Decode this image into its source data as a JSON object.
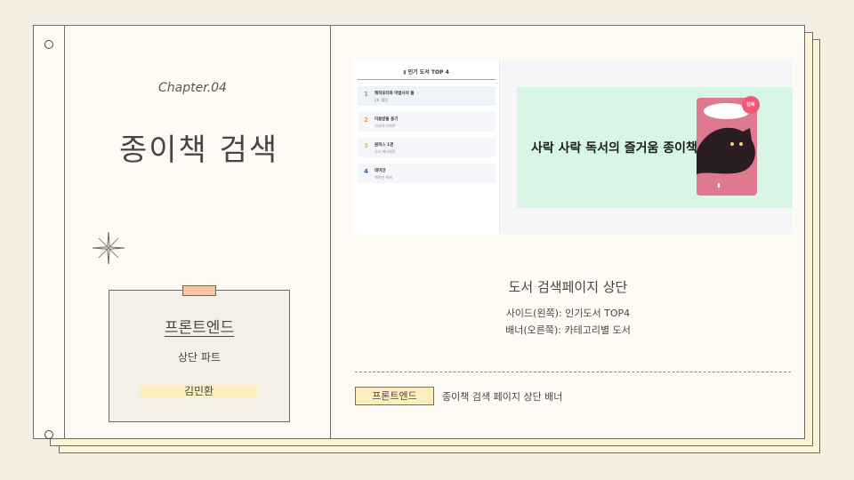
{
  "left": {
    "chapter": "Chapter.04",
    "title": "종이책 검색",
    "card": {
      "title": "프론트엔드",
      "subtitle": "상단 파트",
      "name": "김민환"
    }
  },
  "screenshot": {
    "side": {
      "header": "인기 도서 TOP 4",
      "items": [
        {
          "rank": "1",
          "book": "해피포터와 마법사의 돌",
          "author": "J.K. 롤링"
        },
        {
          "rank": "2",
          "book": "미움받을 용기",
          "author": "기시미 이치로"
        },
        {
          "rank": "3",
          "book": "원피스 1권",
          "author": "오다 에이치로"
        },
        {
          "rank": "4",
          "book": "데미안",
          "author": "헤르만 헤세"
        }
      ]
    },
    "banner": {
      "text": "사락 사락 독서의 즐거움 종이책",
      "badge": "단독",
      "cover_color": "#df7a8e",
      "background_color": "#d8f6e6"
    }
  },
  "right": {
    "desc_title": "도서 검색페이지 상단",
    "desc_lines": [
      "사이드(왼쪽): 인기도서 TOP4",
      "배너(오른쪽): 카테고리별 도서"
    ],
    "tag": "프론트엔드",
    "tag_description": "종이책 검색 페이지 상단 배너"
  },
  "colors": {
    "background": "#f5efe3",
    "paper": "#fdfbf4",
    "highlight": "#fdeec0",
    "tape": "#f6c6a4"
  }
}
